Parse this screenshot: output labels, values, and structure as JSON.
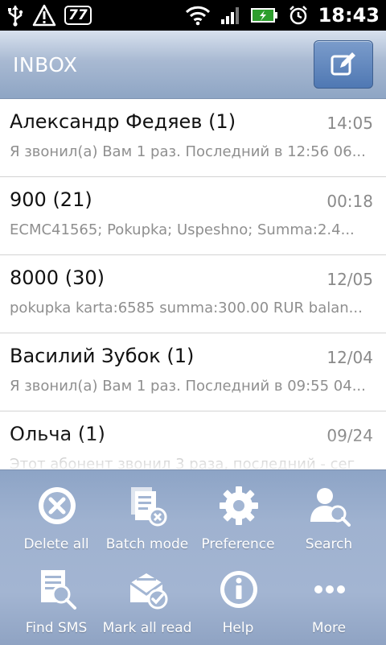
{
  "status_bar": {
    "badge": "77",
    "time": "18:43"
  },
  "header": {
    "title": "INBOX"
  },
  "messages": [
    {
      "name": "Александр Федяев (1)",
      "time": "14:05",
      "preview": "Я звонил(а) Вам 1 раз. Последний в 12:56 06..."
    },
    {
      "name": "900 (21)",
      "time": "00:18",
      "preview": "ECMC41565; Pokupka; Uspeshno; Summa:2.4..."
    },
    {
      "name": "8000 (30)",
      "time": "12/05",
      "preview": "pokupka karta:6585 summa:300.00 RUR balan..."
    },
    {
      "name": "Василий Зубок (1)",
      "time": "12/04",
      "preview": "Я звонил(а) Вам 1 раз. Последний в 09:55 04..."
    },
    {
      "name": "Ольча (1)",
      "time": "09/24",
      "preview": "Этот абонент звонил 3 раза, последний - сег"
    }
  ],
  "menu": [
    {
      "label": "Delete all",
      "icon": "delete-all-icon"
    },
    {
      "label": "Batch mode",
      "icon": "batch-mode-icon"
    },
    {
      "label": "Preference",
      "icon": "gear-icon"
    },
    {
      "label": "Search",
      "icon": "search-contact-icon"
    },
    {
      "label": "Find SMS",
      "icon": "find-sms-icon"
    },
    {
      "label": "Mark all read",
      "icon": "mark-read-icon"
    },
    {
      "label": "Help",
      "icon": "info-icon"
    },
    {
      "label": "More",
      "icon": "more-icon"
    }
  ]
}
